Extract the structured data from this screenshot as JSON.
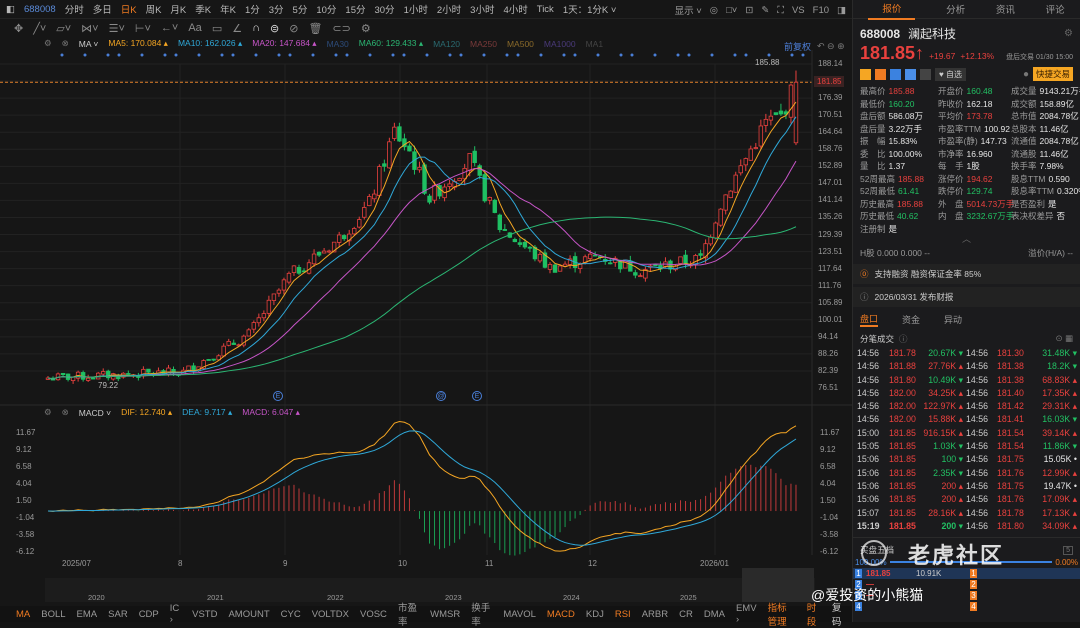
{
  "toolbar": {
    "code": "688008",
    "periods": [
      "分时",
      "多日",
      "日K",
      "周K",
      "月K",
      "季K",
      "年K",
      "1分",
      "3分",
      "5分",
      "10分",
      "15分",
      "30分",
      "1小时",
      "2小时",
      "3小时",
      "4小时",
      "Tick",
      "1天：1分K ˅"
    ],
    "active_period": "日K",
    "right_items": [
      "显示 ˅",
      "◎",
      "□˅",
      "⊡",
      "✎",
      "⛶",
      "VS",
      "F10",
      "◨"
    ]
  },
  "ma_legend": {
    "label": "MA ˅",
    "items": [
      {
        "name": "MA5:",
        "value": "170.084 ▴",
        "color": "#f5a623"
      },
      {
        "name": "MA10:",
        "value": "162.026 ▴",
        "color": "#2fa8d8"
      },
      {
        "name": "MA20:",
        "value": "147.684 ▴",
        "color": "#c755c8"
      },
      {
        "name": "MA30",
        "value": "",
        "color": "#2c4a78"
      },
      {
        "name": "MA60:",
        "value": "129.433 ▴",
        "color": "#2bb673"
      },
      {
        "name": "MA120",
        "value": "",
        "color": "#2a6a70"
      },
      {
        "name": "MA250",
        "value": "",
        "color": "#7a3a3a"
      },
      {
        "name": "MA500",
        "value": "",
        "color": "#8a6a2a"
      },
      {
        "name": "MA1000",
        "value": "",
        "color": "#4a3a7a"
      },
      {
        "name": "MA1",
        "value": "",
        "color": "#444"
      }
    ]
  },
  "adjust_label": "前复权",
  "price_axis": [
    "188.14",
    "176.39",
    "170.51",
    "164.64",
    "158.76",
    "152.89",
    "147.01",
    "141.14",
    "135.26",
    "129.39",
    "123.51",
    "117.64",
    "111.76",
    "105.89",
    "100.01",
    "94.14",
    "88.26",
    "82.39",
    "76.51"
  ],
  "current_price_tag": "181.85",
  "high_label": "185.88",
  "low_label": "79.22",
  "event_markers": [
    "E",
    "@",
    "E"
  ],
  "macd_legend": {
    "label": "MACD ˅",
    "dif": "DIF: 12.740 ▴",
    "dea": "DEA: 9.717 ▴",
    "macd": "MACD: 6.047 ▴"
  },
  "macd_axis": [
    "11.67",
    "9.12",
    "6.58",
    "4.04",
    "1.50",
    "-1.04",
    "-3.58",
    "-6.12"
  ],
  "date_axis": [
    "2025/07",
    "8",
    "9",
    "10",
    "11",
    "12",
    "2026/01"
  ],
  "navigator_years": [
    "2020",
    "2021",
    "2022",
    "2023",
    "2024",
    "2025"
  ],
  "indicators": [
    "MA",
    "BOLL",
    "EMA",
    "SAR",
    "CDP",
    "IC ›",
    "VSTD",
    "AMOUNT",
    "CYC",
    "VOLTDX",
    "VOSC",
    "市盈率",
    "WMSR",
    "换手率",
    "MAVOL",
    "MACD",
    "KDJ",
    "RSI",
    "ARBR",
    "CR",
    "DMA",
    "EMV ›",
    "指标管理"
  ],
  "active_indicators": [
    "MA",
    "MACD",
    "RSI",
    "指标管理"
  ],
  "bottom_right": [
    "时段",
    "复码"
  ],
  "chart_data": {
    "type": "candlestick",
    "bars": 150,
    "price_keypoints": [
      [
        0,
        80
      ],
      [
        27,
        82
      ],
      [
        40,
        95
      ],
      [
        48,
        115
      ],
      [
        58,
        128
      ],
      [
        64,
        140
      ],
      [
        69,
        165
      ],
      [
        72,
        158
      ],
      [
        76,
        142
      ],
      [
        84,
        155
      ],
      [
        90,
        132
      ],
      [
        100,
        118
      ],
      [
        110,
        122
      ],
      [
        118,
        117
      ],
      [
        130,
        121
      ],
      [
        134,
        140
      ],
      [
        143,
        168
      ],
      [
        146,
        170
      ],
      [
        149,
        181.85
      ]
    ],
    "ylim": [
      76.51,
      188.14
    ],
    "macd_ylim": [
      -6.12,
      11.67
    ],
    "last": {
      "dif": 12.74,
      "dea": 9.717,
      "macd": 6.047
    }
  },
  "panel": {
    "tabs": [
      "报价",
      "分析",
      "资讯",
      "评论"
    ],
    "code": "688008",
    "name": "澜起科技",
    "price": "181.85↑",
    "change": "+19.67",
    "pct": "+12.13%",
    "session": "盘后交易 01/30 15:00",
    "watch": "♥ 自选",
    "quick_trade": "快捷交易",
    "stats": [
      [
        "最高价",
        "185.88",
        "red",
        "开盘价",
        "160.48",
        "green",
        "成交量",
        "9143.21万手",
        "white"
      ],
      [
        "最低价",
        "160.20",
        "green",
        "昨收价",
        "162.18",
        "white",
        "成交额",
        "158.89亿",
        "white"
      ],
      [
        "盘后额",
        "586.08万",
        "white",
        "平均价",
        "173.78",
        "red",
        "总市值",
        "2084.78亿",
        "white"
      ],
      [
        "盘后量",
        "3.22万手",
        "white",
        "市盈率TTM",
        "100.92",
        "white",
        "总股本",
        "11.46亿",
        "white"
      ],
      [
        "振　幅",
        "15.83%",
        "white",
        "市盈率(静)",
        "147.73",
        "white",
        "流通值",
        "2084.78亿",
        "white"
      ],
      [
        "委　比",
        "100.00%",
        "white",
        "市净率",
        "16.960",
        "white",
        "流通股",
        "11.46亿",
        "white"
      ],
      [
        "量　比",
        "1.37",
        "white",
        "每　手",
        "1股",
        "white",
        "换手率",
        "7.98%",
        "white"
      ],
      [
        "52周最高",
        "185.88",
        "red",
        "涨停价",
        "194.62",
        "red",
        "股息TTM",
        "0.590",
        "white"
      ],
      [
        "52周最低",
        "61.41",
        "green",
        "跌停价",
        "129.74",
        "green",
        "股息率TTM",
        "0.320%",
        "white"
      ],
      [
        "历史最高",
        "185.88",
        "red",
        "外　盘",
        "5014.73万手",
        "red",
        "是否盈利",
        "是",
        "white"
      ],
      [
        "历史最低",
        "40.62",
        "green",
        "内　盘",
        "3232.67万手",
        "green",
        "表决权差异",
        "否",
        "white"
      ],
      [
        "注册制",
        "是",
        "white",
        "",
        "",
        "",
        "",
        "",
        ""
      ]
    ],
    "h_share": "H股  0.000  0.000  --",
    "premium": "溢价(H/A)  --",
    "margin": "支持融资  融资保证金率 85%",
    "report": "2026/03/31  发布财报",
    "subtabs": [
      "盘口",
      "资金",
      "异动"
    ],
    "ticks_title": "分笔成交",
    "trades_left": [
      [
        "14:56",
        "181.78",
        "20.67K",
        "down"
      ],
      [
        "14:56",
        "181.88",
        "27.76K",
        "up"
      ],
      [
        "14:56",
        "181.80",
        "10.49K",
        "down"
      ],
      [
        "14:56",
        "182.00",
        "34.25K",
        "up"
      ],
      [
        "14:56",
        "182.00",
        "122.97K",
        "up"
      ],
      [
        "14:56",
        "182.00",
        "15.88K",
        "up"
      ],
      [
        "15:00",
        "181.85",
        "916.15K",
        "up"
      ],
      [
        "15:05",
        "181.85",
        "1.03K",
        "down"
      ],
      [
        "15:06",
        "181.85",
        "100",
        "down"
      ],
      [
        "15:06",
        "181.85",
        "2.35K",
        "down"
      ],
      [
        "15:06",
        "181.85",
        "200",
        "up"
      ],
      [
        "15:06",
        "181.85",
        "200",
        "up"
      ],
      [
        "15:07",
        "181.85",
        "28.16K",
        "up"
      ],
      [
        "15:19",
        "181.85",
        "200",
        "down"
      ]
    ],
    "trades_right": [
      [
        "14:56",
        "181.30",
        "31.48K",
        "down"
      ],
      [
        "14:56",
        "181.38",
        "18.2K",
        "down"
      ],
      [
        "14:56",
        "181.38",
        "68.83K",
        "up"
      ],
      [
        "14:56",
        "181.40",
        "17.35K",
        "up"
      ],
      [
        "14:56",
        "181.42",
        "29.31K",
        "up"
      ],
      [
        "14:56",
        "181.41",
        "16.03K",
        "down"
      ],
      [
        "14:56",
        "181.54",
        "39.14K",
        "up"
      ],
      [
        "14:56",
        "181.54",
        "11.86K",
        "down"
      ],
      [
        "14:56",
        "181.75",
        "15.05K",
        "neutral"
      ],
      [
        "14:56",
        "181.76",
        "12.99K",
        "up"
      ],
      [
        "14:56",
        "181.75",
        "19.47K",
        "neutral"
      ],
      [
        "14:56",
        "181.76",
        "17.09K",
        "up"
      ],
      [
        "14:56",
        "181.78",
        "17.13K",
        "up"
      ],
      [
        "14:56",
        "181.80",
        "34.09K",
        "up"
      ]
    ],
    "orderbook": {
      "title": "买盘五档",
      "bid_pct": "100.00%",
      "ask_pct": "0.00%",
      "bids": [
        [
          "1",
          "181.85",
          "10.91K"
        ],
        [
          "2",
          "—",
          ""
        ],
        [
          "3",
          "—",
          ""
        ],
        [
          "4",
          "",
          ""
        ]
      ],
      "asks": [
        "1",
        "2",
        "3",
        "4"
      ]
    },
    "watermark": "老虎社区",
    "author": "@爱投资的小熊猫"
  }
}
